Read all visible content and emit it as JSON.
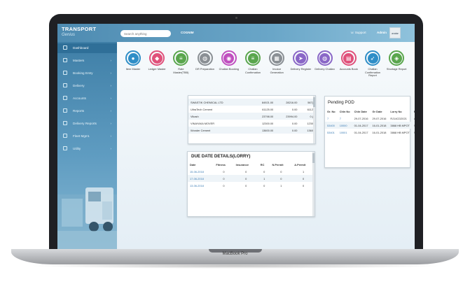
{
  "app": {
    "brand_title": "TRANSPORT",
    "brand_sub": "Genius",
    "search_placeholder": "Search anything",
    "company": "COGNIM",
    "support": "Support",
    "user": "Admin",
    "avatar_text": "avatar"
  },
  "laptop_model": "MacBook Pro",
  "sidebar": [
    {
      "label": "Dashboard",
      "icon": "dashboard-icon",
      "active": true,
      "arrow": false
    },
    {
      "label": "Masters",
      "icon": "masters-icon",
      "active": false,
      "arrow": true
    },
    {
      "label": "Booking Entry",
      "icon": "booking-icon",
      "active": false,
      "arrow": true
    },
    {
      "label": "Delivery",
      "icon": "delivery-icon",
      "active": false,
      "arrow": true
    },
    {
      "label": "Accounts",
      "icon": "accounts-icon",
      "active": false,
      "arrow": true
    },
    {
      "label": "Reports",
      "icon": "reports-icon",
      "active": false,
      "arrow": true
    },
    {
      "label": "Delivery Reports",
      "icon": "delivery-reports-icon",
      "active": false,
      "arrow": true
    },
    {
      "label": "Fleet Mgmt.",
      "icon": "fleet-icon",
      "active": false,
      "arrow": true
    },
    {
      "label": "Utility",
      "icon": "utility-icon",
      "active": false,
      "arrow": true
    }
  ],
  "quick_icons": [
    {
      "label": "Item Master",
      "icon": "user-icon",
      "color": "#2f8ec7"
    },
    {
      "label": "Ledger Master",
      "icon": "tag-icon",
      "color": "#e0507a"
    },
    {
      "label": "Rate Master(TBB)",
      "icon": "list-icon",
      "color": "#5aa64d"
    },
    {
      "label": "DR Preparation",
      "icon": "chat-icon",
      "color": "#8a8f94"
    },
    {
      "label": "Challan Booking",
      "icon": "eye-icon",
      "color": "#c04fbf"
    },
    {
      "label": "Challan Confirmation",
      "icon": "list-icon",
      "color": "#5aa64d"
    },
    {
      "label": "Invoice Generation",
      "icon": "grid-icon",
      "color": "#8a8f94"
    },
    {
      "label": "Delivery Register",
      "icon": "send-icon",
      "color": "#8a67c7"
    },
    {
      "label": "Delivery Challan",
      "icon": "chat-icon",
      "color": "#8a67c7"
    },
    {
      "label": "Accounts Book",
      "icon": "book-icon",
      "color": "#e0507a"
    },
    {
      "label": "Challan Confirmation Report",
      "icon": "rocket-icon",
      "color": "#2f8ec7"
    },
    {
      "label": "Shortage Report",
      "icon": "map-icon",
      "color": "#5aa64d"
    }
  ],
  "ledger_table": {
    "rows": [
      [
        "SWASTIK CHEMICAL LTD",
        "84921.00",
        "28216.00",
        "567("
      ],
      [
        "UltraTech Cement",
        "61125.00",
        "0.00",
        "6112"
      ],
      [
        "Vikash",
        "23798.00",
        "23994.00",
        "0.("
      ],
      [
        "VINAYAKA MOVER",
        "12300.00",
        "0.00",
        "1230"
      ],
      [
        "Wonder Cement",
        "13600.00",
        "0.00",
        "1360"
      ]
    ]
  },
  "due_date": {
    "title": "DUE DATE DETAILS(LORRY)",
    "columns": [
      "Date",
      "Fitness",
      "Insurance",
      "RC",
      "N.Permit",
      "A.Permit"
    ],
    "rows": [
      [
        "15-06-2018",
        "0",
        "0",
        "0",
        "0",
        "1"
      ],
      [
        "17-06-2018",
        "0",
        "0",
        "1",
        "0",
        "0"
      ],
      [
        "13-06-2018",
        "0",
        "0",
        "0",
        "1",
        "0"
      ]
    ]
  },
  "pod": {
    "title": "Pending POD",
    "columns": [
      "Gr. No",
      "Chln No",
      "Chln Date",
      "Gr Date",
      "Lorry No",
      "Party N"
    ],
    "rows": [
      [
        "7",
        "7",
        "29-07-2016",
        "29-07-2016",
        "RJ14CD2021",
        "Aman"
      ],
      [
        "53400",
        "10000",
        "01-04-2017",
        "16-01-2018",
        "3868 HB MPOT",
        "SWASTIK"
      ],
      [
        "53401",
        "10001",
        "01-04-2017",
        "16-01-2018",
        "3868 HB MPOT",
        "SWASTIK"
      ]
    ]
  }
}
